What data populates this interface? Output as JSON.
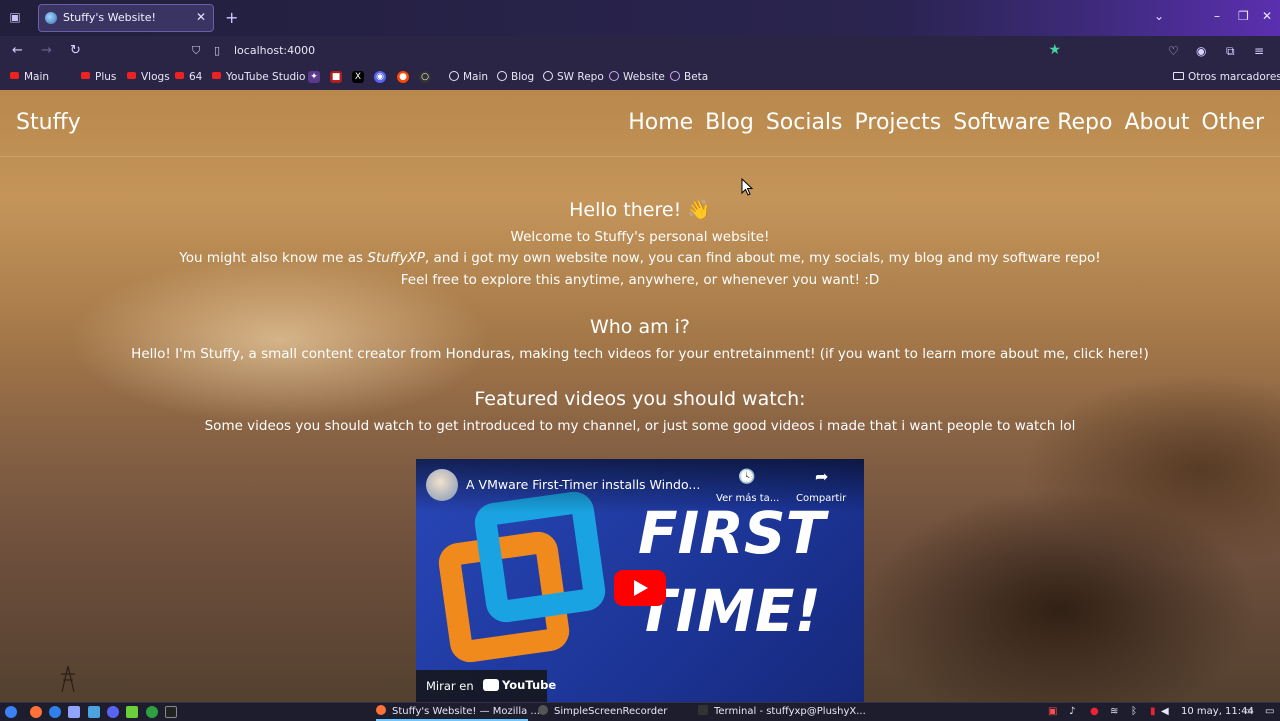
{
  "browser": {
    "tab_title": "Stuffy's Website!",
    "new_tab": "+",
    "url": "localhost:4000",
    "bookmarks": [
      {
        "label": "Main",
        "icon": "youtube-icon"
      },
      {
        "label": "Plus",
        "icon": "youtube-icon"
      },
      {
        "label": "Vlogs",
        "icon": "youtube-icon"
      },
      {
        "label": "64",
        "icon": "youtube-icon"
      },
      {
        "label": "YouTube Studio",
        "icon": "youtube-icon"
      },
      {
        "label": "Main",
        "icon": "github-icon"
      },
      {
        "label": "Blog",
        "icon": "github-icon"
      },
      {
        "label": "SW Repo",
        "icon": "github-icon"
      },
      {
        "label": "Website",
        "icon": "globe-icon"
      },
      {
        "label": "Beta",
        "icon": "globe-icon"
      }
    ],
    "other_bookmarks": "Otros marcadores"
  },
  "site": {
    "title": "Stuffy",
    "nav": [
      "Home",
      "Blog",
      "Socials",
      "Projects",
      "Software Repo",
      "About",
      "Other"
    ],
    "hello_heading": "Hello there! 👋",
    "welcome": "Welcome to Stuffy's personal website!",
    "aka_before": "You might also know me as ",
    "aka_name": "StuffyXP",
    "aka_after": ", and i got my own website now, you can find about me, my socials, my blog and my software repo!",
    "explore": "Feel free to explore this anytime, anywhere, or whenever you want! :D",
    "who_heading": "Who am i?",
    "who_text": "Hello! I'm Stuffy, a small content creator from Honduras, making tech videos for your entretainment! (if you want to learn more about me, click here!)",
    "featured_heading": "Featured videos you should watch:",
    "featured_text": "Some videos you should watch to get introduced to my channel, or just some good videos i made that i want people to watch lol"
  },
  "video": {
    "title": "A VMware First-Timer installs Windo...",
    "watch_later": "Ver más ta...",
    "share": "Compartir",
    "thumb_line1": "FIRST",
    "thumb_line2": "TIME!",
    "watch_on": "Mirar en",
    "youtube": "YouTube"
  },
  "taskbar": {
    "windows": [
      {
        "label": "Stuffy's Website! — Mozilla ...",
        "active": true
      },
      {
        "label": "SimpleScreenRecorder",
        "active": false
      },
      {
        "label": "Terminal - stuffyxp@PlushyX...",
        "active": false
      }
    ],
    "clock": "10 may, 11:44"
  },
  "colors": {
    "accent_star": "#45d39b",
    "youtube_red": "#ff0000",
    "tab_bg": "#3a3463"
  }
}
